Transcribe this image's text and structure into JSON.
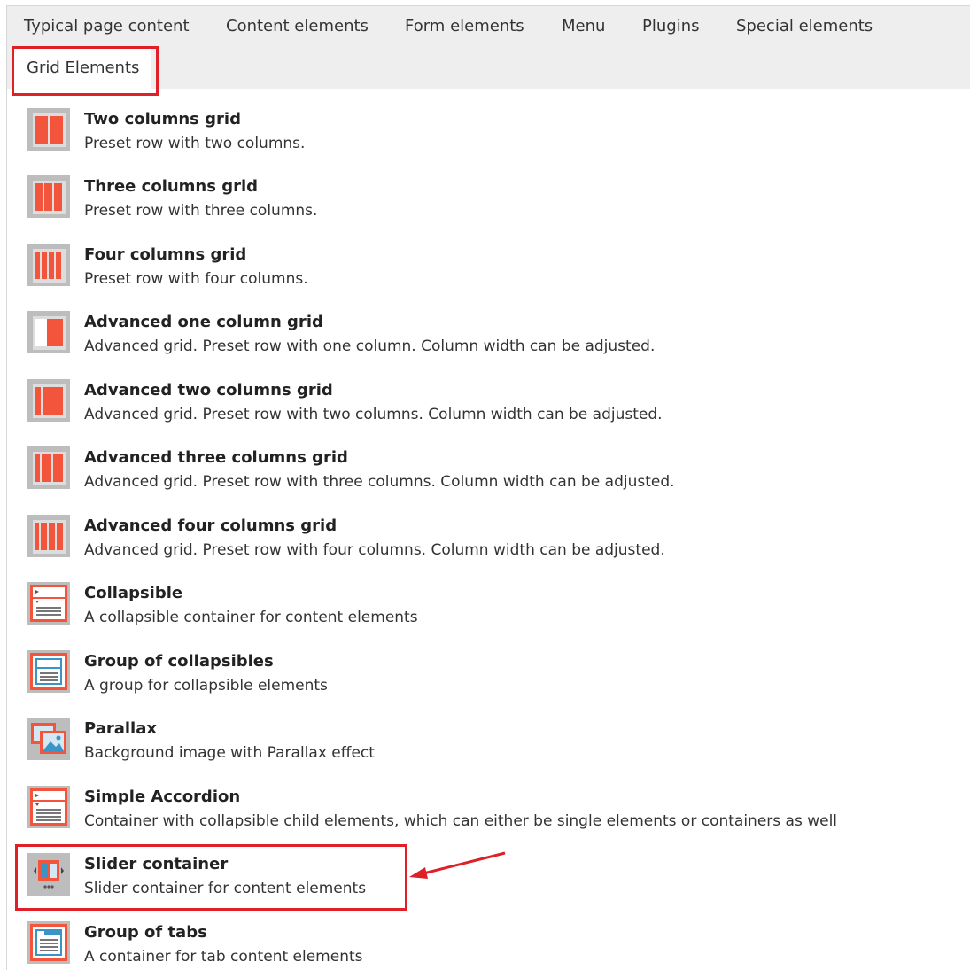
{
  "tabs": [
    {
      "label": "Typical page content"
    },
    {
      "label": "Content elements"
    },
    {
      "label": "Form elements"
    },
    {
      "label": "Menu"
    },
    {
      "label": "Plugins"
    },
    {
      "label": "Special elements"
    },
    {
      "label": "Grid Elements",
      "active": true
    }
  ],
  "items": [
    {
      "title": "Two columns grid",
      "description": "Preset row with two columns.",
      "icon": "two-columns-grid-icon"
    },
    {
      "title": "Three columns grid",
      "description": "Preset row with three columns.",
      "icon": "three-columns-grid-icon"
    },
    {
      "title": "Four columns grid",
      "description": "Preset row with four columns.",
      "icon": "four-columns-grid-icon"
    },
    {
      "title": "Advanced one column grid",
      "description": "Advanced grid. Preset row with one column. Column width can be adjusted.",
      "icon": "advanced-one-column-grid-icon"
    },
    {
      "title": "Advanced two columns grid",
      "description": "Advanced grid. Preset row with two columns. Column width can be adjusted.",
      "icon": "advanced-two-columns-grid-icon"
    },
    {
      "title": "Advanced three columns grid",
      "description": "Advanced grid. Preset row with three columns. Column width can be adjusted.",
      "icon": "advanced-three-columns-grid-icon"
    },
    {
      "title": "Advanced four columns grid",
      "description": "Advanced grid. Preset row with four columns. Column width can be adjusted.",
      "icon": "advanced-four-columns-grid-icon"
    },
    {
      "title": "Collapsible",
      "description": "A collapsible container for content elements",
      "icon": "collapsible-icon"
    },
    {
      "title": "Group of collapsibles",
      "description": "A group for collapsible elements",
      "icon": "group-of-collapsibles-icon"
    },
    {
      "title": "Parallax",
      "description": "Background image with Parallax effect",
      "icon": "parallax-icon"
    },
    {
      "title": "Simple Accordion",
      "description": "Container with collapsible child elements, which can either be single elements or containers as well",
      "icon": "simple-accordion-icon"
    },
    {
      "title": "Slider container",
      "description": "Slider container for content elements",
      "icon": "slider-container-icon",
      "highlighted": true
    },
    {
      "title": "Group of tabs",
      "description": "A container for tab content elements",
      "icon": "group-of-tabs-icon"
    }
  ],
  "colors": {
    "accent_red": "#e01f26",
    "icon_orange": "#f2553b",
    "icon_blue": "#3a95c7",
    "tabbar_bg": "#eeeeee"
  }
}
